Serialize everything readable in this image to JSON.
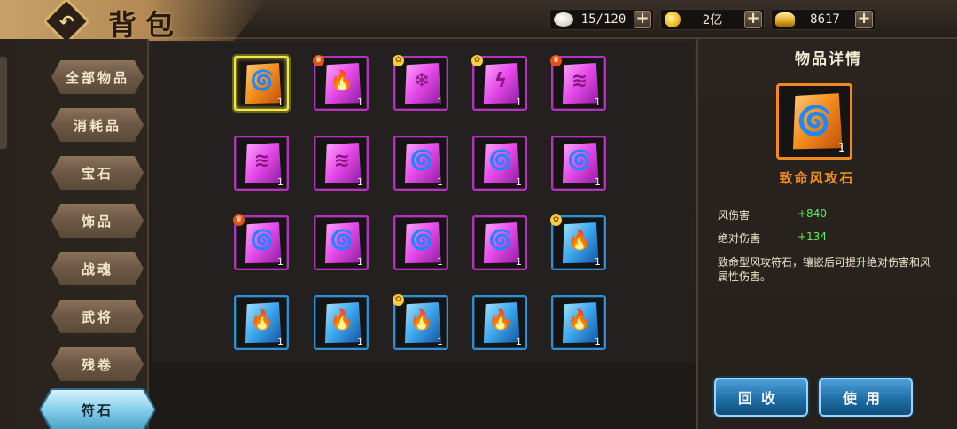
{
  "header": {
    "title": "背包",
    "back_icon": "back-arrow-icon"
  },
  "resources": [
    {
      "name": "egg",
      "icon": "egg-icon",
      "value": "15/120"
    },
    {
      "name": "coin",
      "icon": "gold-coin-icon",
      "value": "2亿"
    },
    {
      "name": "ingot",
      "icon": "gold-ingot-icon",
      "value": "8617"
    }
  ],
  "plus_label": "+",
  "nav": {
    "items": [
      {
        "label": "全部物品"
      },
      {
        "label": "消耗品"
      },
      {
        "label": "宝石"
      },
      {
        "label": "饰品"
      },
      {
        "label": "战魂"
      },
      {
        "label": "武将"
      },
      {
        "label": "残卷"
      },
      {
        "label": "符石"
      }
    ],
    "active_index": 7
  },
  "grid": {
    "items": [
      {
        "color": "orange",
        "element": "wind",
        "qty": "1",
        "badge": "",
        "selected": true
      },
      {
        "color": "purple",
        "element": "fire",
        "qty": "1",
        "badge": "crown"
      },
      {
        "color": "purple",
        "element": "ice",
        "qty": "1",
        "badge": "flower"
      },
      {
        "color": "purple",
        "element": "lightning",
        "qty": "1",
        "badge": "flower"
      },
      {
        "color": "purple",
        "element": "claw",
        "qty": "1",
        "badge": "crown"
      },
      {
        "color": "purple",
        "element": "claw",
        "qty": "1",
        "badge": ""
      },
      {
        "color": "purple",
        "element": "claw",
        "qty": "1",
        "badge": ""
      },
      {
        "color": "purple",
        "element": "wind",
        "qty": "1",
        "badge": ""
      },
      {
        "color": "purple",
        "element": "wind",
        "qty": "1",
        "badge": ""
      },
      {
        "color": "purple",
        "element": "wind",
        "qty": "1",
        "badge": ""
      },
      {
        "color": "purple",
        "element": "wind",
        "qty": "1",
        "badge": "crown"
      },
      {
        "color": "purple",
        "element": "wind",
        "qty": "1",
        "badge": ""
      },
      {
        "color": "purple",
        "element": "wind",
        "qty": "1",
        "badge": ""
      },
      {
        "color": "purple",
        "element": "wind",
        "qty": "1",
        "badge": ""
      },
      {
        "color": "blue",
        "element": "fire",
        "qty": "1",
        "badge": "flower"
      },
      {
        "color": "blue",
        "element": "fire",
        "qty": "1",
        "badge": ""
      },
      {
        "color": "blue",
        "element": "fire",
        "qty": "1",
        "badge": ""
      },
      {
        "color": "blue",
        "element": "fire",
        "qty": "1",
        "badge": "flower"
      },
      {
        "color": "blue",
        "element": "fire",
        "qty": "1",
        "badge": ""
      },
      {
        "color": "blue",
        "element": "fire",
        "qty": "1",
        "badge": ""
      }
    ]
  },
  "detail": {
    "title": "物品详情",
    "item_name": "致命风攻石",
    "item_qty": "1",
    "item_color": "orange",
    "item_element": "wind",
    "stats": [
      {
        "label": "风伤害",
        "value": "+840"
      },
      {
        "label": "绝对伤害",
        "value": "+134"
      }
    ],
    "description": "致命型风攻符石，镶嵌后可提升绝对伤害和风属性伤害。",
    "recycle_label": "回收",
    "use_label": "使用"
  }
}
